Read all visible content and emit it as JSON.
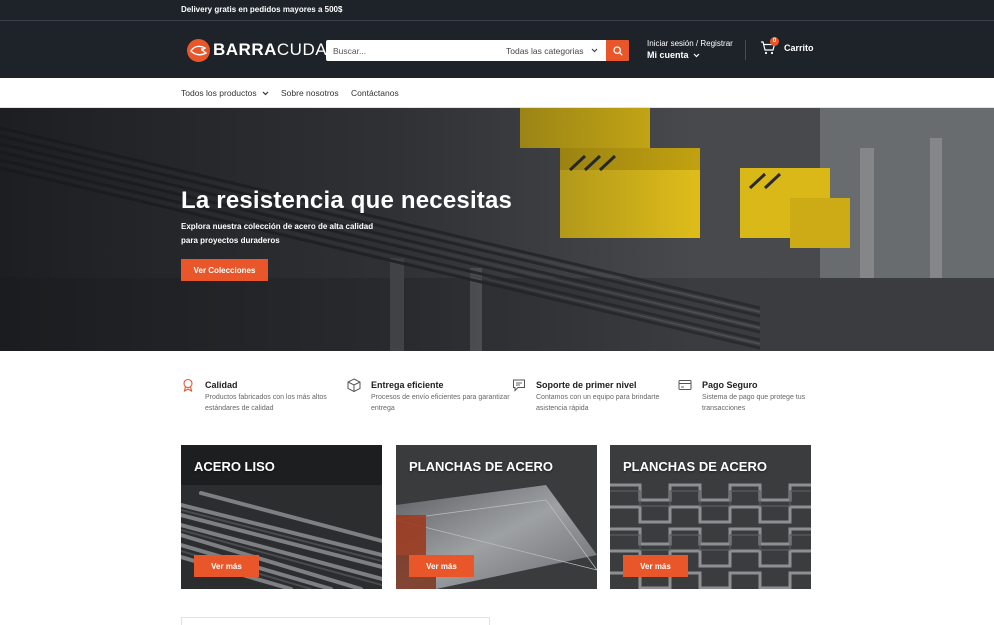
{
  "announcement": {
    "text": "Delivery gratis en pedidos mayores a 500$"
  },
  "header": {
    "logo": {
      "part1": "BARRA",
      "part2": "CUDA"
    },
    "search": {
      "placeholder": "Buscar...",
      "category": "Todas las categorias"
    },
    "account": {
      "login": "Iniciar sesión",
      "separator": " / ",
      "register": "Registrar",
      "my_account": "Mi cuenta"
    },
    "cart": {
      "count": "0",
      "label": "Carrito"
    }
  },
  "nav": {
    "items": [
      {
        "label": "Todos los productos"
      },
      {
        "label": "Sobre nosotros"
      },
      {
        "label": "Contáctanos"
      }
    ]
  },
  "hero": {
    "title": "La resistencia que necesitas",
    "subtitle": "Explora nuestra colección de acero de alta calidad para proyectos duraderos",
    "cta": "Ver Colecciones"
  },
  "features": [
    {
      "icon": "award-icon",
      "title": "Calidad",
      "desc": "Productos fabricados con los más altos estándares de calidad"
    },
    {
      "icon": "box-icon",
      "title": "Entrega eficiente",
      "desc": "Procesos de envío eficientes para garantizar entrega"
    },
    {
      "icon": "chat-icon",
      "title": "Soporte de primer nivel",
      "desc": "Contamos con un equipo para brindarte asistencia rápida"
    },
    {
      "icon": "credit-card-icon",
      "title": "Pago Seguro",
      "desc": "Sistema de pago que protege tus transacciones"
    }
  ],
  "collections": [
    {
      "title": "ACERO LISO",
      "cta": "Ver más"
    },
    {
      "title": "PLANCHAS DE ACERO",
      "cta": "Ver más"
    },
    {
      "title": "PLANCHAS DE ACERO",
      "cta": "Ver más"
    }
  ],
  "colors": {
    "accent": "#e8562a",
    "header_bg": "#1e2329"
  }
}
